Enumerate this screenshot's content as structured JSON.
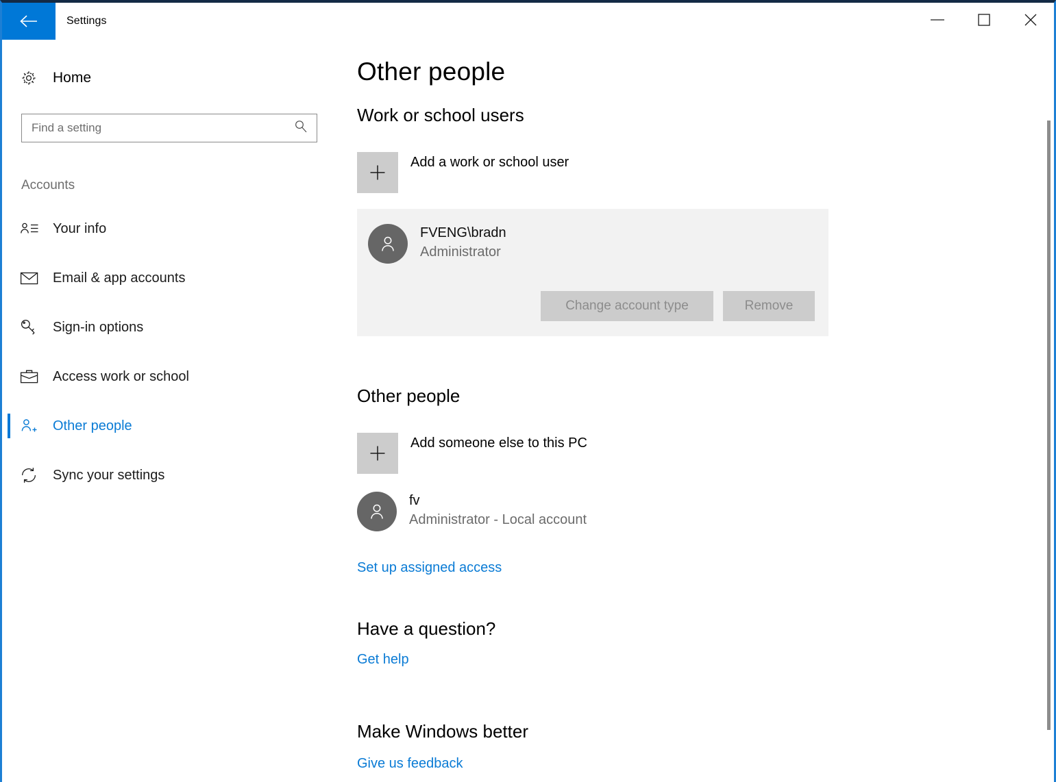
{
  "window": {
    "title": "Settings",
    "back_icon": "back-arrow-icon",
    "minimize_label": "Minimize",
    "maximize_label": "Maximize",
    "close_label": "Close",
    "accent_color": "#0078d7",
    "border_color": "#1d7fd4"
  },
  "sidebar": {
    "home_label": "Home",
    "home_icon": "gear-icon",
    "search": {
      "placeholder": "Find a setting",
      "value": "",
      "icon": "search-icon"
    },
    "group_header": "Accounts",
    "items": [
      {
        "label": "Your info",
        "icon": "person-list-icon",
        "active": false
      },
      {
        "label": "Email & app accounts",
        "icon": "envelope-icon",
        "active": false
      },
      {
        "label": "Sign-in options",
        "icon": "key-icon",
        "active": false
      },
      {
        "label": "Access work or school",
        "icon": "briefcase-icon",
        "active": false
      },
      {
        "label": "Other people",
        "icon": "person-add-icon",
        "active": true
      },
      {
        "label": "Sync your settings",
        "icon": "sync-icon",
        "active": false
      }
    ]
  },
  "main": {
    "page_title": "Other people",
    "work_school": {
      "heading": "Work or school users",
      "add_label": "Add a work or school user",
      "add_icon": "plus-icon",
      "user": {
        "name": "FVENG\\bradn",
        "role": "Administrator",
        "avatar_icon": "person-avatar-icon",
        "selected": true
      },
      "buttons": {
        "change_account_type": "Change account type",
        "remove": "Remove"
      }
    },
    "other_people": {
      "heading": "Other people",
      "add_label": "Add someone else to this PC",
      "add_icon": "plus-icon",
      "user": {
        "name": "fv",
        "role": "Administrator - Local account",
        "avatar_icon": "person-avatar-icon"
      },
      "assigned_access_link": "Set up assigned access"
    },
    "question": {
      "heading": "Have a question?",
      "link": "Get help"
    },
    "feedback": {
      "heading": "Make Windows better",
      "link": "Give us feedback"
    }
  },
  "colors": {
    "link": "#0a7bd5",
    "card_bg": "#f2f2f2",
    "plus_box": "#cccccc",
    "avatar": "#666666",
    "disabled_button_bg": "#cccccc",
    "disabled_button_text": "#8c8c8c"
  }
}
